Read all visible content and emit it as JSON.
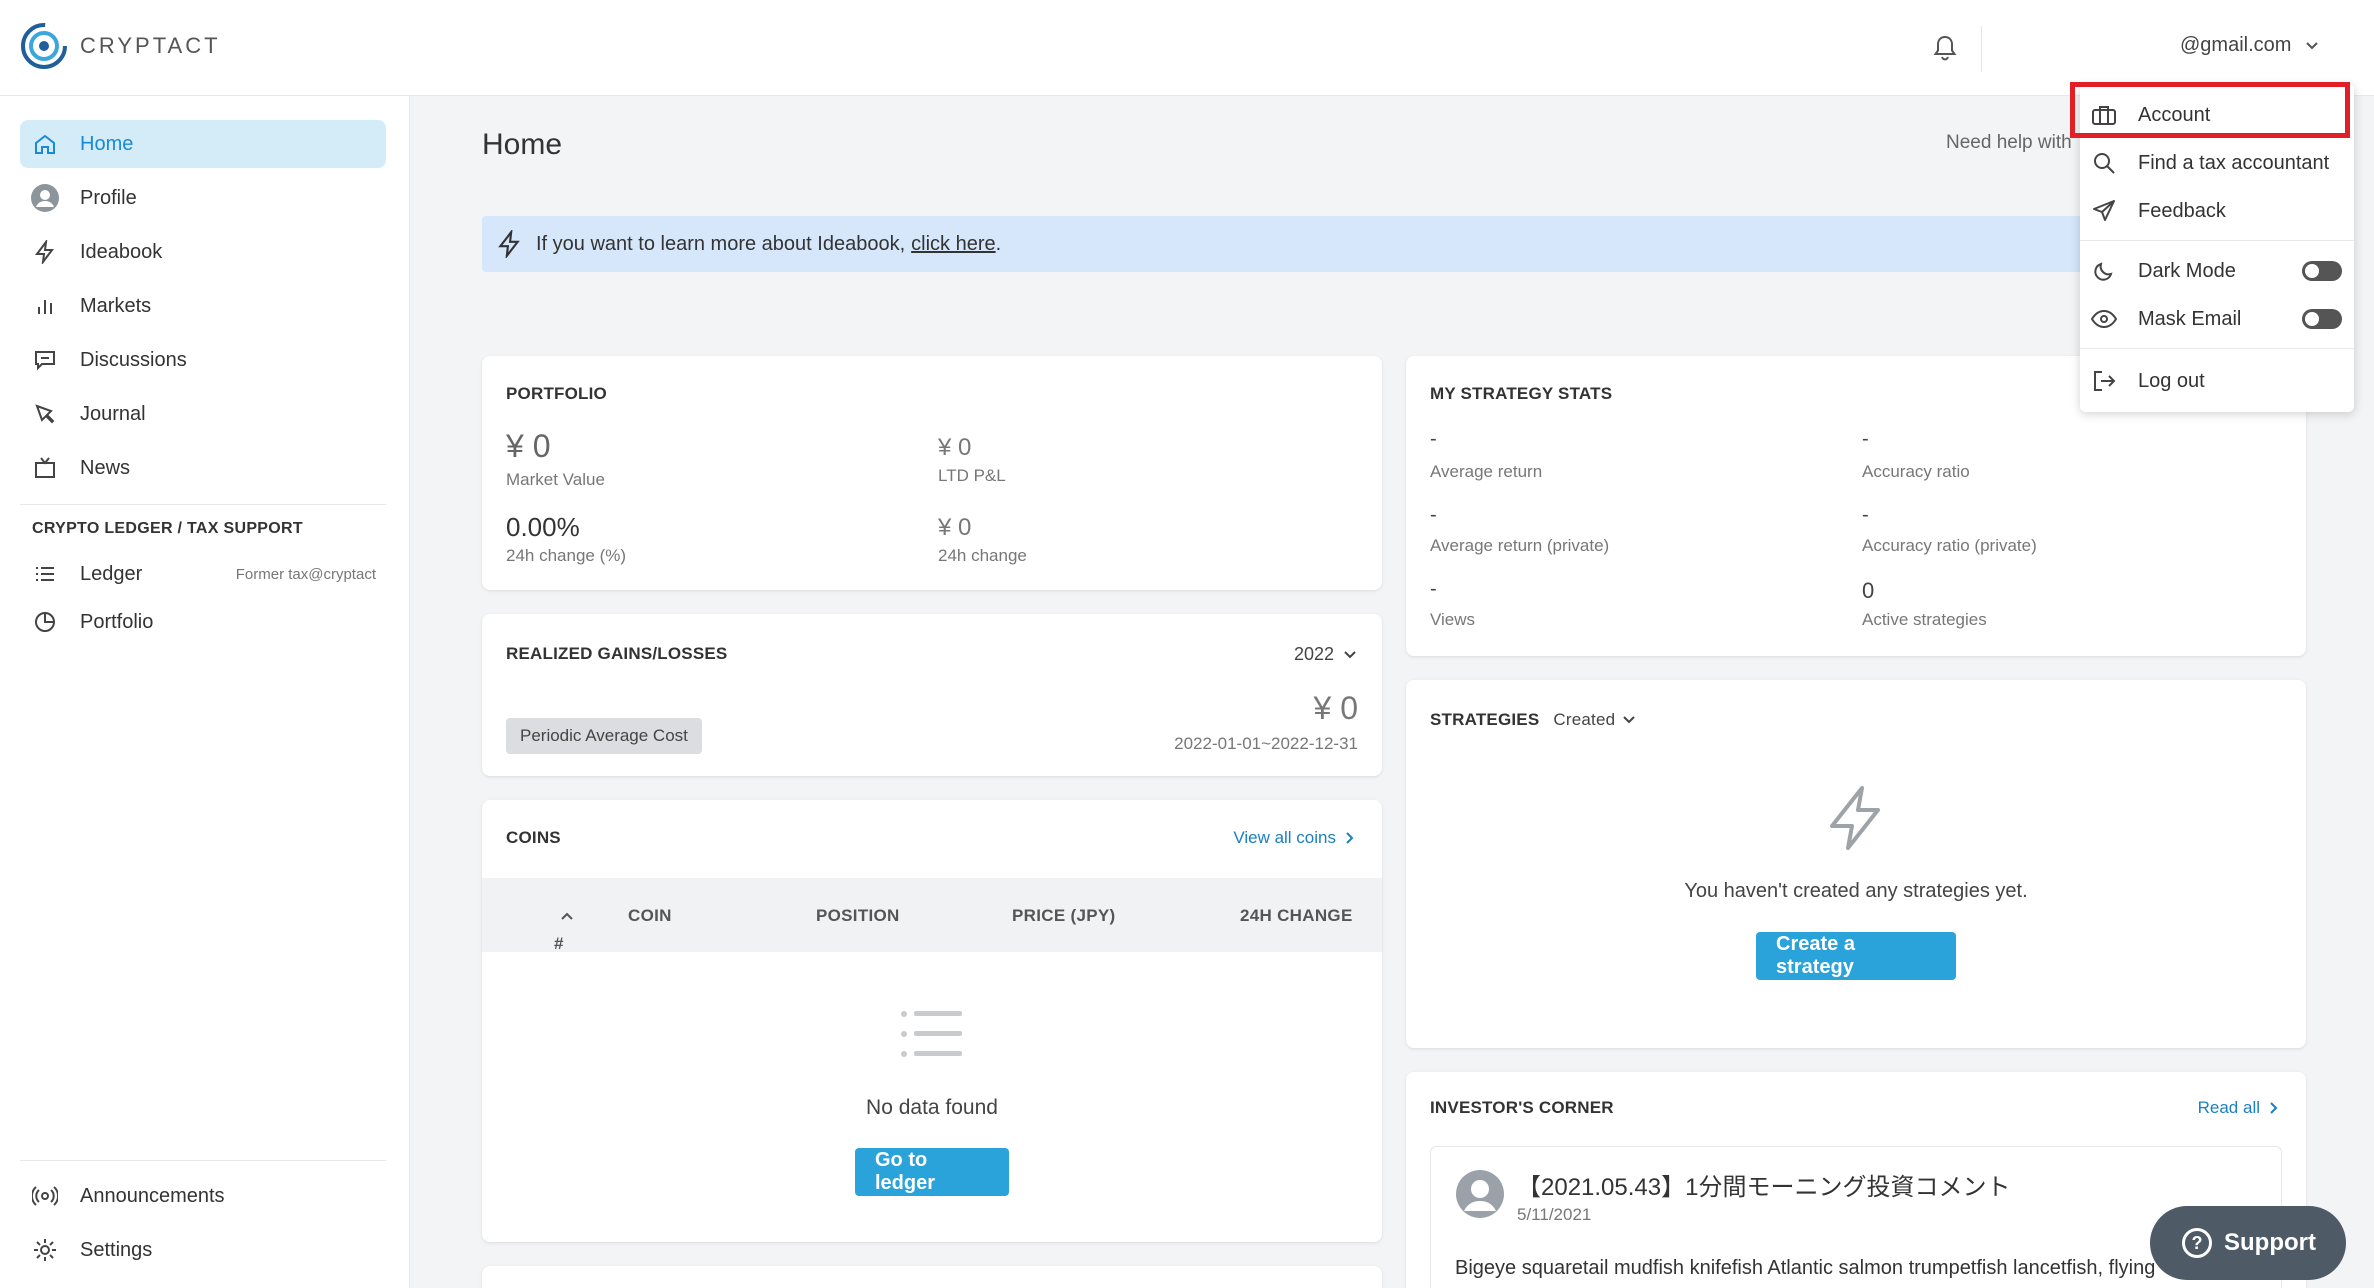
{
  "app": {
    "brand": "CRYPTACT"
  },
  "header": {
    "user_email": "@gmail.com"
  },
  "sidebar": {
    "items": [
      {
        "label": "Home",
        "icon": "home-icon"
      },
      {
        "label": "Profile",
        "icon": "avatar-icon"
      },
      {
        "label": "Ideabook",
        "icon": "bolt-icon"
      },
      {
        "label": "Markets",
        "icon": "bar-chart-icon"
      },
      {
        "label": "Discussions",
        "icon": "chat-icon"
      },
      {
        "label": "Journal",
        "icon": "pen-icon"
      },
      {
        "label": "News",
        "icon": "tv-icon"
      }
    ],
    "section_heading": "CRYPTO LEDGER / TAX SUPPORT",
    "ledger": {
      "label": "Ledger",
      "sublabel": "Former tax@cryptact"
    },
    "portfolio": {
      "label": "Portfolio"
    },
    "announcements": "Announcements",
    "settings": "Settings"
  },
  "page": {
    "title": "Home",
    "need_help": "Need help with",
    "banner": {
      "text": "If you want to learn more about Ideabook,",
      "link": "click here",
      "end": "."
    }
  },
  "portfolio": {
    "title": "PORTFOLIO",
    "market_value": "¥ 0",
    "market_value_label": "Market Value",
    "ltd_pl": "¥ 0",
    "ltd_pl_label": "LTD P&L",
    "change_pct": "0.00%",
    "change_pct_label": "24h change (%)",
    "change": "¥ 0",
    "change_label": "24h change"
  },
  "realized": {
    "title": "REALIZED GAINS/LOSSES",
    "year": "2022",
    "method": "Periodic Average Cost",
    "value": "¥ 0",
    "range": "2022-01-01~2022-12-31"
  },
  "coins": {
    "title": "COINS",
    "view_all": "View all coins",
    "columns": [
      "#",
      "COIN",
      "POSITION",
      "PRICE (JPY)",
      "24H CHANGE"
    ],
    "empty": "No data found",
    "button": "Go to ledger"
  },
  "strategy_stats": {
    "title": "MY STRATEGY STATS",
    "avg_return": "-",
    "avg_return_label": "Average return",
    "accuracy": "-",
    "accuracy_label": "Accuracy ratio",
    "avg_return_private": "-",
    "avg_return_private_label": "Average return (private)",
    "accuracy_private": "-",
    "accuracy_private_label": "Accuracy ratio (private)",
    "views": "-",
    "views_label": "Views",
    "active": "0",
    "active_label": "Active strategies"
  },
  "strategies": {
    "title": "STRATEGIES",
    "filter": "Created",
    "empty": "You haven't created any strategies yet.",
    "button": "Create a strategy"
  },
  "investors_corner": {
    "title": "INVESTOR'S CORNER",
    "read_all": "Read all",
    "post_title": "【2021.05.43】1分間モーニング投資コメント",
    "post_date": "5/11/2021",
    "post_excerpt": "Bigeye squaretail mudfish knifefish Atlantic salmon trumpetfish lancetfish, flying"
  },
  "account_menu": {
    "items": [
      {
        "label": "Account",
        "icon": "briefcase-icon"
      },
      {
        "label": "Find a tax accountant",
        "icon": "search-icon"
      },
      {
        "label": "Feedback",
        "icon": "send-icon"
      },
      {
        "label": "Dark Mode",
        "icon": "moon-icon",
        "toggle": false
      },
      {
        "label": "Mask Email",
        "icon": "eye-icon",
        "toggle": false
      },
      {
        "label": "Log out",
        "icon": "logout-icon"
      }
    ]
  },
  "support": {
    "label": "Support"
  },
  "colors": {
    "accent": "#2aa2da",
    "active_bg": "#d4ebf8",
    "banner_bg": "#d6e6fb",
    "highlight": "#e01f26"
  }
}
